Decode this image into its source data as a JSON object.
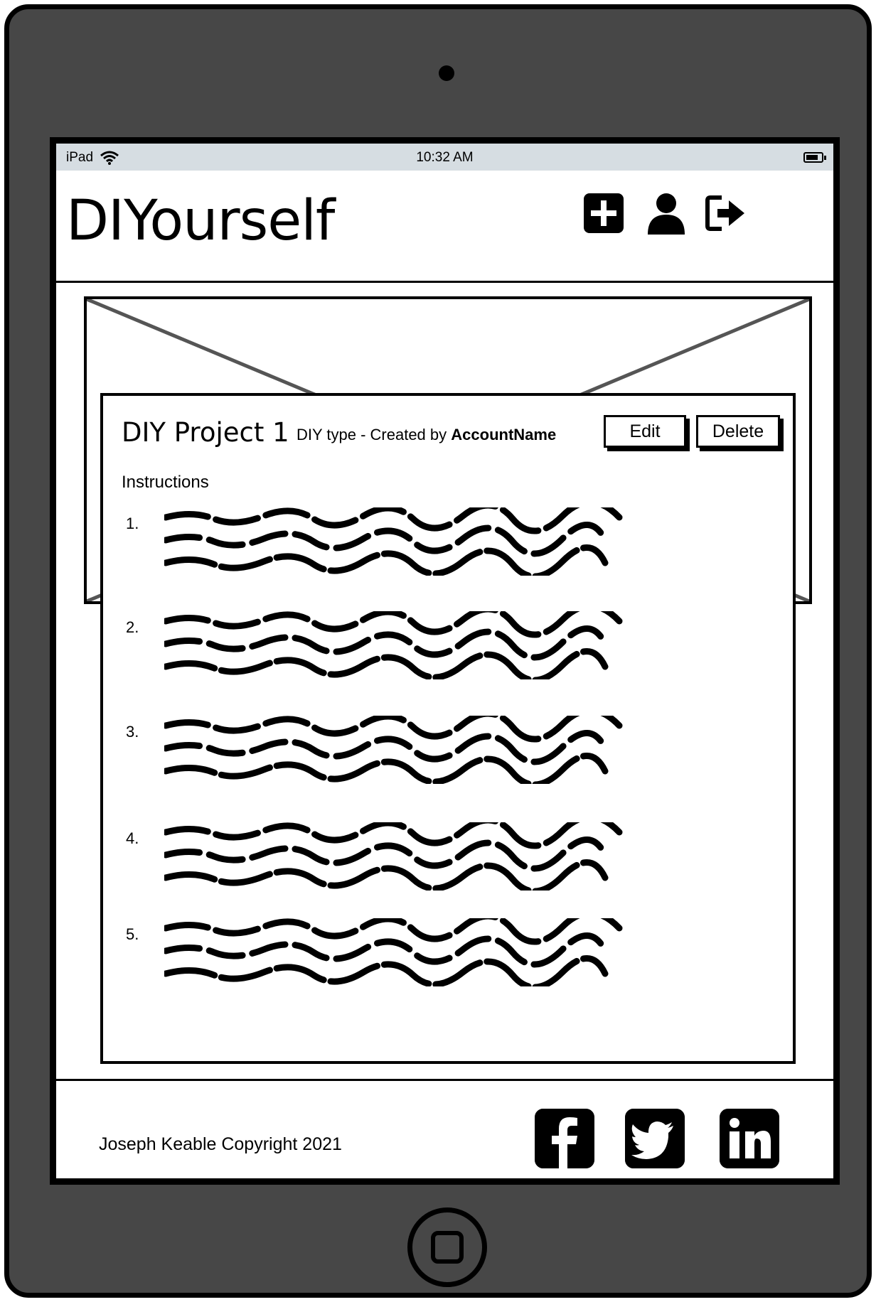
{
  "statusbar": {
    "device": "iPad",
    "time": "10:32 AM"
  },
  "header": {
    "brand": "DIYourself",
    "icons": [
      "plus-square-icon",
      "user-icon",
      "sign-out-icon"
    ]
  },
  "project": {
    "title": "DIY Project 1",
    "meta_prefix": "DIY type - Created by",
    "account": "AccountName",
    "edit_label": "Edit",
    "delete_label": "Delete",
    "instructions_heading": "Instructions",
    "steps": [
      {
        "number": "1."
      },
      {
        "number": "2."
      },
      {
        "number": "3."
      },
      {
        "number": "4."
      },
      {
        "number": "5."
      }
    ]
  },
  "footer": {
    "copyright": "Joseph Keable Copyright 2021",
    "social": [
      "facebook-icon",
      "twitter-icon",
      "linkedin-icon"
    ]
  },
  "colors": {
    "frame": "#474747",
    "statusbar": "#d6dde2",
    "ink": "#000000"
  }
}
